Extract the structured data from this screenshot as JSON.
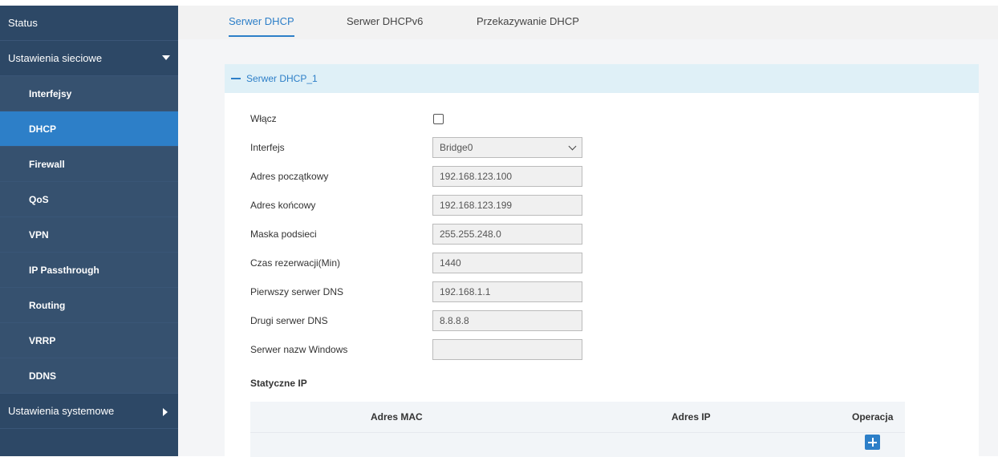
{
  "sidebar": {
    "status": "Status",
    "network_settings": "Ustawienia sieciowe",
    "sub_items": [
      "Interfejsy",
      "DHCP",
      "Firewall",
      "QoS",
      "VPN",
      "IP Passthrough",
      "Routing",
      "VRRP",
      "DDNS"
    ],
    "active_item": "DHCP",
    "system_settings": "Ustawienia systemowe"
  },
  "tabs": [
    "Serwer DHCP",
    "Serwer DHCPv6",
    "Przekazywanie DHCP"
  ],
  "active_tab": "Serwer DHCP",
  "panel": {
    "title": "Serwer DHCP_1",
    "fields": {
      "enable_label": "Włącz",
      "interface_label": "Interfejs",
      "interface_value": "Bridge0",
      "start_label": "Adres początkowy",
      "start_value": "192.168.123.100",
      "end_label": "Adres końcowy",
      "end_value": "192.168.123.199",
      "mask_label": "Maska podsieci",
      "mask_value": "255.255.248.0",
      "lease_label": "Czas rezerwacji(Min)",
      "lease_value": "1440",
      "dns1_label": "Pierwszy serwer DNS",
      "dns1_value": "192.168.1.1",
      "dns2_label": "Drugi serwer DNS",
      "dns2_value": "8.8.8.8",
      "wins_label": "Serwer nazw Windows",
      "wins_value": ""
    },
    "static_ip": {
      "title": "Statyczne IP",
      "columns": [
        "Adres MAC",
        "Adres IP",
        "Operacja"
      ]
    }
  },
  "colors": {
    "sidebar_bg": "#2d4866",
    "active_blue": "#2d7fc8",
    "panel_header_bg": "#dff0f7"
  }
}
